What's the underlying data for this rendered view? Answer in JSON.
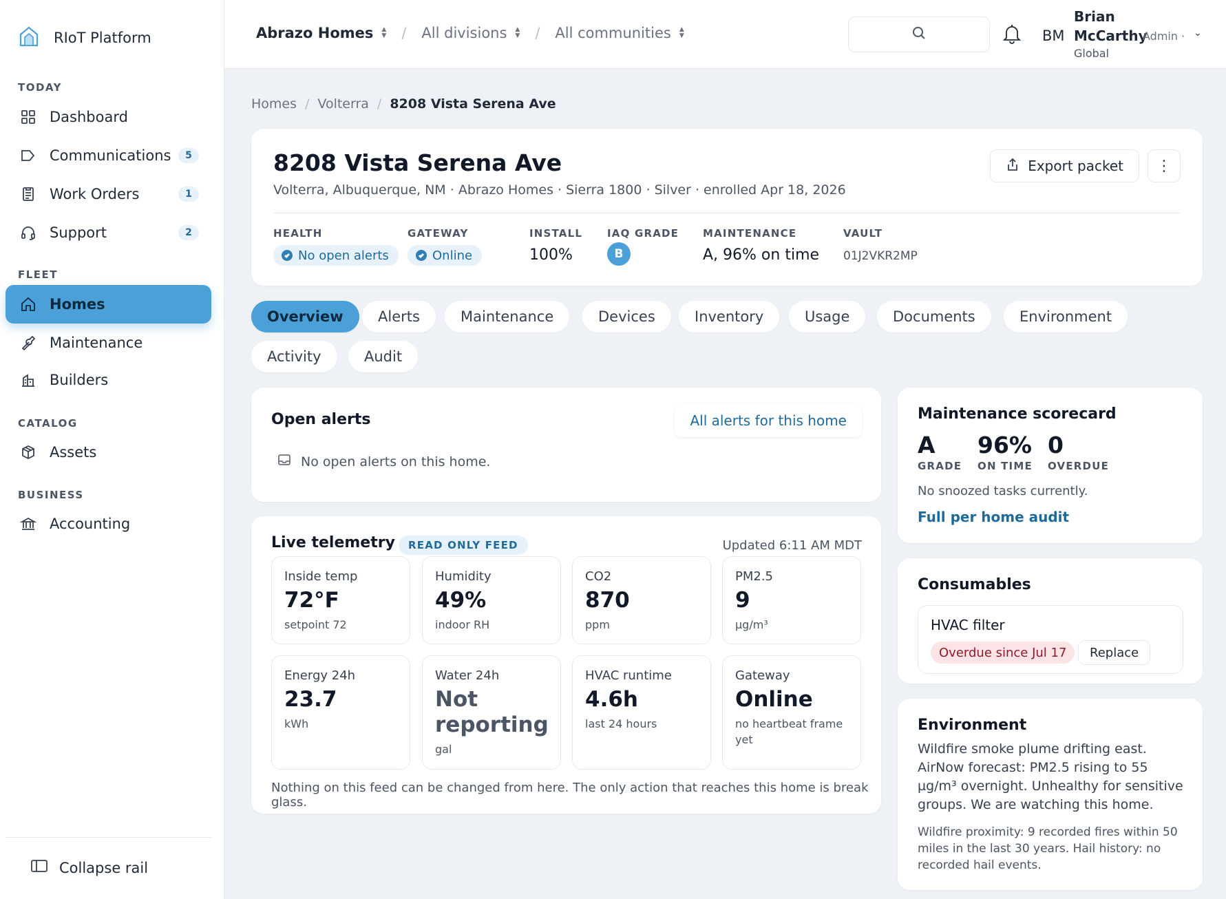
{
  "sidebar": {
    "brand": "RIoT Platform",
    "sections": {
      "today": "TODAY",
      "fleet": "FLEET",
      "catalog": "CATALOG",
      "business": "BUSINESS"
    },
    "items": [
      {
        "label": "Dashboard",
        "icon": "grid-icon"
      },
      {
        "label": "Communications",
        "icon": "megaphone-icon",
        "badge": "5"
      },
      {
        "label": "Work Orders",
        "icon": "clipboard-icon",
        "badge": "1"
      },
      {
        "label": "Support",
        "icon": "headset-icon",
        "badge": "2"
      },
      {
        "label": "Homes",
        "icon": "home-icon",
        "active": true
      },
      {
        "label": "Maintenance",
        "icon": "wrench-icon"
      },
      {
        "label": "Builders",
        "icon": "building-icon"
      },
      {
        "label": "Assets",
        "icon": "box-icon"
      },
      {
        "label": "Accounting",
        "icon": "bank-icon"
      }
    ],
    "collapse_label": "Collapse rail",
    "accent": "#4aa0d7"
  },
  "topbar": {
    "org": "Abrazo Homes",
    "division": "All divisions",
    "community": "All communities",
    "user": {
      "initials": "BM",
      "first_name": "Brian",
      "last_name": "McCarthy",
      "role": "Admin ·",
      "scope": "Global"
    }
  },
  "breadcrumb": [
    "Homes",
    "Volterra",
    "8208 Vista Serena Ave"
  ],
  "home": {
    "title": "8208 Vista Serena Ave",
    "subtitle": "Volterra, Albuquerque, NM · Abrazo Homes · Sierra 1800 · Silver · enrolled Apr 18, 2026",
    "export_label": "Export packet",
    "more_label": "⋮",
    "stats": {
      "health": {
        "label": "HEALTH",
        "value": "No open alerts"
      },
      "gateway": {
        "label": "GATEWAY",
        "value": "Online"
      },
      "install": {
        "label": "INSTALL",
        "value": "100%"
      },
      "iaq": {
        "label": "IAQ GRADE",
        "value": "B"
      },
      "maintenance": {
        "label": "MAINTENANCE",
        "value": "A, 96% on time"
      },
      "vault": {
        "label": "VAULT",
        "value": "01J2VKR2MP"
      }
    }
  },
  "tabs": [
    "Overview",
    "Alerts",
    "Maintenance",
    "Devices",
    "Inventory",
    "Usage",
    "Documents",
    "Environment",
    "Activity",
    "Audit"
  ],
  "alerts": {
    "title": "Open alerts",
    "link": "All alerts for this home",
    "empty": "No open alerts on this home."
  },
  "telemetry": {
    "title": "Live telemetry",
    "badge": "READ ONLY FEED",
    "updated": "Updated 6:11 AM MDT",
    "tiles": [
      {
        "label": "Inside temp",
        "value": "72°F",
        "sub": "setpoint 72"
      },
      {
        "label": "Humidity",
        "value": "49%",
        "sub": "indoor RH"
      },
      {
        "label": "CO2",
        "value": "870",
        "sub": "ppm"
      },
      {
        "label": "PM2.5",
        "value": "9",
        "sub": "µg/m³"
      },
      {
        "label": "Energy 24h",
        "value": "23.7",
        "sub": "kWh"
      },
      {
        "label": "Water 24h",
        "value": "Not reporting",
        "sub": "gal"
      },
      {
        "label": "HVAC runtime",
        "value": "4.6h",
        "sub": "last 24 hours"
      },
      {
        "label": "Gateway",
        "value": "Online",
        "sub": "no heartbeat frame yet"
      }
    ],
    "footer": "Nothing on this feed can be changed from here. The only action that reaches this home is break glass."
  },
  "scorecard": {
    "title": "Maintenance scorecard",
    "grade": {
      "value": "A",
      "label": "GRADE"
    },
    "on_time": {
      "value": "96%",
      "label": "ON TIME"
    },
    "overdue": {
      "value": "0",
      "label": "OVERDUE"
    },
    "note": "No snoozed tasks currently.",
    "link": "Full per home audit"
  },
  "consumables": {
    "title": "Consumables",
    "item": "HVAC filter",
    "status": "Overdue since Jul 17",
    "action": "Replace"
  },
  "environment": {
    "title": "Environment",
    "body": "Wildfire smoke plume drifting east. AirNow forecast: PM2.5 rising to 55 µg/m³ overnight. Unhealthy for sensitive groups. We are watching this home.",
    "detail": "Wildfire proximity: 9 recorded fires within 50 miles in the last 30 years. Hail history: no recorded hail events."
  }
}
